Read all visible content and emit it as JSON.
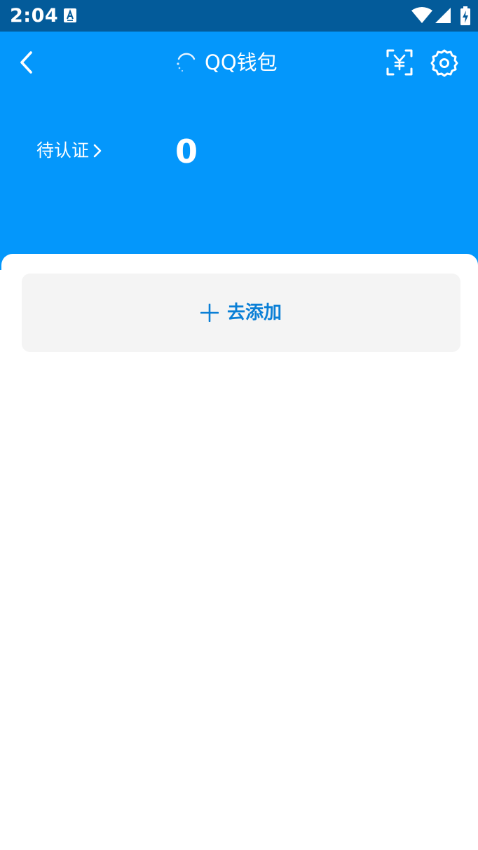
{
  "status_bar": {
    "time": "2:04",
    "app_icon": "a-badge-icon",
    "icons": [
      "wifi-icon",
      "signal-icon",
      "battery-charging-icon"
    ]
  },
  "header": {
    "title": "QQ钱包",
    "back_icon": "chevron-left-icon",
    "loading_icon": "loading-spinner-icon",
    "scan_icon": "scan-yuan-icon",
    "settings_icon": "gear-icon",
    "pending_label": "待认证",
    "pending_count": "0"
  },
  "content": {
    "add_label": "去添加",
    "add_icon": "plus-icon"
  },
  "colors": {
    "status_bar": "#035b9a",
    "header": "#0497fb",
    "accent_text": "#0a7fd6",
    "card_bg": "#f4f4f4"
  }
}
